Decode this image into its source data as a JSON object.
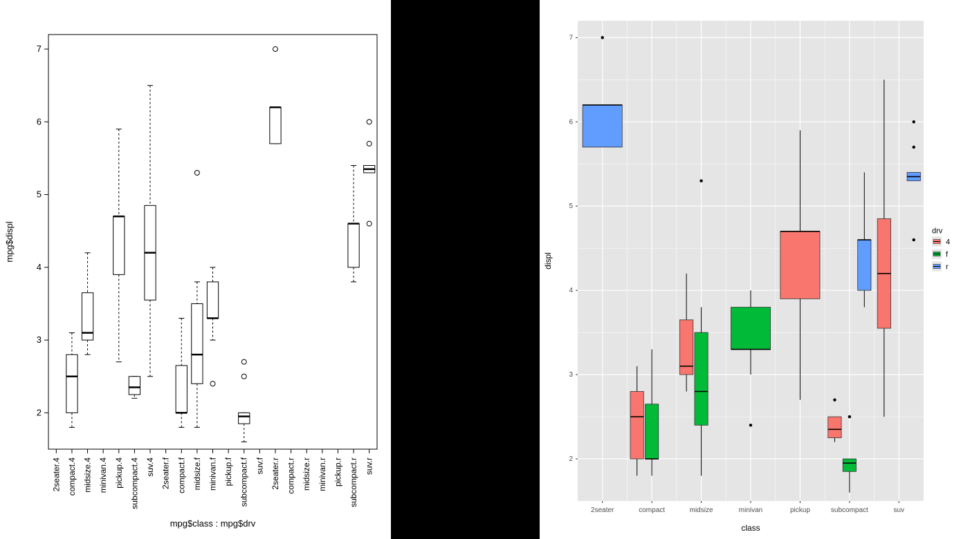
{
  "chart_data": [
    {
      "type": "boxplot",
      "title": "",
      "xlabel": "mpg$class : mpg$drv",
      "ylabel": "mpg$displ",
      "ylim": [
        1.5,
        7.2
      ],
      "yticks": [
        2,
        3,
        4,
        5,
        6,
        7
      ],
      "categories": [
        "2seater.4",
        "compact.4",
        "midsize.4",
        "minivan.4",
        "pickup.4",
        "subcompact.4",
        "suv.4",
        "2seater.f",
        "compact.f",
        "midsize.f",
        "minivan.f",
        "pickup.f",
        "subcompact.f",
        "suv.f",
        "2seater.r",
        "compact.r",
        "midsize.r",
        "minivan.r",
        "pickup.r",
        "subcompact.r",
        "suv.r"
      ],
      "boxes": {
        "compact.4": {
          "lw": 1.8,
          "q1": 2.0,
          "med": 2.5,
          "q3": 2.8,
          "uw": 3.1
        },
        "midsize.4": {
          "lw": 2.8,
          "q1": 3.0,
          "med": 3.1,
          "q3": 3.65,
          "uw": 4.2
        },
        "pickup.4": {
          "lw": 2.7,
          "q1": 3.9,
          "med": 4.7,
          "q3": 4.7,
          "uw": 5.9
        },
        "subcompact.4": {
          "lw": 2.2,
          "q1": 2.25,
          "med": 2.35,
          "q3": 2.5,
          "uw": 2.5
        },
        "suv.4": {
          "lw": 2.5,
          "q1": 3.55,
          "med": 4.2,
          "q3": 4.85,
          "uw": 6.5
        },
        "compact.f": {
          "lw": 1.8,
          "q1": 2.0,
          "med": 2.0,
          "q3": 2.65,
          "uw": 3.3
        },
        "midsize.f": {
          "lw": 1.8,
          "q1": 2.4,
          "med": 2.8,
          "q3": 3.5,
          "uw": 3.8,
          "outliers": [
            5.3
          ]
        },
        "minivan.f": {
          "lw": 3.0,
          "q1": 3.3,
          "med": 3.3,
          "q3": 3.8,
          "uw": 4.0,
          "outliers": [
            2.4
          ]
        },
        "subcompact.f": {
          "lw": 1.6,
          "q1": 1.85,
          "med": 1.95,
          "q3": 2.0,
          "uw": 2.0,
          "outliers": [
            2.5,
            2.7
          ]
        },
        "2seater.r": {
          "lw": 5.7,
          "q1": 5.7,
          "med": 6.2,
          "q3": 6.2,
          "uw": 6.2,
          "outliers": [
            7.0
          ]
        },
        "subcompact.r": {
          "lw": 3.8,
          "q1": 4.0,
          "med": 4.6,
          "q3": 4.6,
          "uw": 5.4
        },
        "suv.r": {
          "lw": 5.3,
          "q1": 5.3,
          "med": 5.35,
          "q3": 5.4,
          "uw": 5.4,
          "outliers": [
            4.6,
            5.7,
            6.0
          ]
        }
      }
    },
    {
      "type": "boxplot-grouped",
      "title": "",
      "xlabel": "class",
      "ylabel": "displ",
      "ylim": [
        1.5,
        7.2
      ],
      "yticks": [
        2,
        3,
        4,
        5,
        6,
        7
      ],
      "categories": [
        "2seater",
        "compact",
        "midsize",
        "minivan",
        "pickup",
        "subcompact",
        "suv"
      ],
      "group_var": "drv",
      "groups": [
        "4",
        "f",
        "r"
      ],
      "colors": {
        "4": "#F8766D",
        "f": "#00BA38",
        "r": "#619CFF"
      },
      "series": {
        "2seater": {
          "r": {
            "lw": 5.7,
            "q1": 5.7,
            "med": 6.2,
            "q3": 6.2,
            "uw": 6.2,
            "outliers": [
              7.0
            ]
          }
        },
        "compact": {
          "4": {
            "lw": 1.8,
            "q1": 2.0,
            "med": 2.5,
            "q3": 2.8,
            "uw": 3.1
          },
          "f": {
            "lw": 1.8,
            "q1": 2.0,
            "med": 2.0,
            "q3": 2.65,
            "uw": 3.3
          }
        },
        "midsize": {
          "4": {
            "lw": 2.8,
            "q1": 3.0,
            "med": 3.1,
            "q3": 3.65,
            "uw": 4.2
          },
          "f": {
            "lw": 1.8,
            "q1": 2.4,
            "med": 2.8,
            "q3": 3.5,
            "uw": 3.8,
            "outliers": [
              5.3
            ]
          }
        },
        "minivan": {
          "f": {
            "lw": 3.0,
            "q1": 3.3,
            "med": 3.3,
            "q3": 3.8,
            "uw": 4.0,
            "outliers": [
              2.4
            ]
          }
        },
        "pickup": {
          "4": {
            "lw": 2.7,
            "q1": 3.9,
            "med": 4.7,
            "q3": 4.7,
            "uw": 5.9
          }
        },
        "subcompact": {
          "4": {
            "lw": 2.2,
            "q1": 2.25,
            "med": 2.35,
            "q3": 2.5,
            "uw": 2.5,
            "outliers": [
              2.7
            ]
          },
          "f": {
            "lw": 1.6,
            "q1": 1.85,
            "med": 1.95,
            "q3": 2.0,
            "uw": 2.0,
            "outliers": [
              2.5
            ]
          },
          "r": {
            "lw": 3.8,
            "q1": 4.0,
            "med": 4.6,
            "q3": 4.6,
            "uw": 5.4
          }
        },
        "suv": {
          "4": {
            "lw": 2.5,
            "q1": 3.55,
            "med": 4.2,
            "q3": 4.85,
            "uw": 6.5
          },
          "r": {
            "lw": 5.3,
            "q1": 5.3,
            "med": 5.35,
            "q3": 5.4,
            "uw": 5.4,
            "outliers": [
              4.6,
              5.7,
              6.0
            ]
          }
        }
      },
      "legend": {
        "title": "drv",
        "items": [
          "4",
          "f",
          "r"
        ]
      }
    }
  ]
}
